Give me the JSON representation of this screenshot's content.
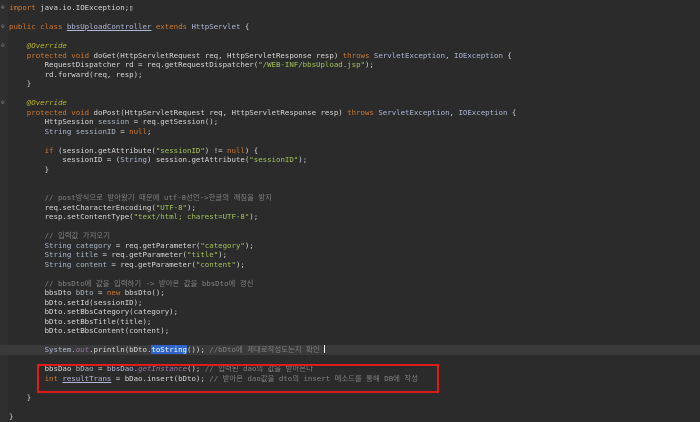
{
  "editor": {
    "lines": [
      {
        "fold": "⊕",
        "tokens": [
          {
            "t": "import",
            "c": "kw"
          },
          {
            "t": " java.io.IOException;",
            "c": "def"
          },
          {
            "t": "▯",
            "c": "def"
          }
        ]
      },
      {
        "tokens": []
      },
      {
        "fold": "⊖",
        "tokens": [
          {
            "t": "public class ",
            "c": "kw"
          },
          {
            "t": "bbsUploadController",
            "c": "link"
          },
          {
            "t": " extends ",
            "c": "kw"
          },
          {
            "t": "HttpServlet",
            "c": "cls"
          },
          {
            "t": " {",
            "c": "def"
          }
        ]
      },
      {
        "tokens": []
      },
      {
        "fold": "⊖",
        "tokens": [
          {
            "t": "    @Override",
            "c": "ann"
          }
        ]
      },
      {
        "tokens": [
          {
            "t": "    protected void ",
            "c": "kw"
          },
          {
            "t": "doGet",
            "c": "def"
          },
          {
            "t": "(HttpServletRequest req, HttpServletResponse resp) ",
            "c": "def"
          },
          {
            "t": "throws ",
            "c": "kw"
          },
          {
            "t": "ServletException",
            "c": "cls"
          },
          {
            "t": ", ",
            "c": "def"
          },
          {
            "t": "IOException",
            "c": "cls"
          },
          {
            "t": " {",
            "c": "def"
          }
        ]
      },
      {
        "tokens": [
          {
            "t": "        RequestDispatcher rd = req.getRequestDispatcher(",
            "c": "def"
          },
          {
            "t": "\"/WEB-INF/bbsUpload.jsp\"",
            "c": "str"
          },
          {
            "t": ");",
            "c": "def"
          }
        ]
      },
      {
        "tokens": [
          {
            "t": "        rd.forward(req, resp);",
            "c": "def"
          }
        ]
      },
      {
        "tokens": [
          {
            "t": "    }",
            "c": "def"
          }
        ]
      },
      {
        "tokens": []
      },
      {
        "fold": "⊖",
        "tokens": [
          {
            "t": "    @Override",
            "c": "ann"
          }
        ]
      },
      {
        "tokens": [
          {
            "t": "    protected void ",
            "c": "kw"
          },
          {
            "t": "doPost",
            "c": "def"
          },
          {
            "t": "(HttpServletRequest req, HttpServletResponse resp) ",
            "c": "def"
          },
          {
            "t": "throws ",
            "c": "kw"
          },
          {
            "t": "ServletException",
            "c": "cls"
          },
          {
            "t": ", ",
            "c": "def"
          },
          {
            "t": "IOException",
            "c": "cls"
          },
          {
            "t": " {",
            "c": "def"
          }
        ]
      },
      {
        "tokens": [
          {
            "t": "        HttpSession ",
            "c": "def"
          },
          {
            "t": "session",
            "c": "var"
          },
          {
            "t": " = req.getSession();",
            "c": "def"
          }
        ]
      },
      {
        "tokens": [
          {
            "t": "        String ",
            "c": "cls"
          },
          {
            "t": "sessionID",
            "c": "var"
          },
          {
            "t": " = ",
            "c": "def"
          },
          {
            "t": "null",
            "c": "kw"
          },
          {
            "t": ";",
            "c": "def"
          }
        ]
      },
      {
        "tokens": []
      },
      {
        "tokens": [
          {
            "t": "        if ",
            "c": "kw"
          },
          {
            "t": "(session.getAttribute(",
            "c": "def"
          },
          {
            "t": "\"sessionID\"",
            "c": "str"
          },
          {
            "t": ") != ",
            "c": "def"
          },
          {
            "t": "null",
            "c": "kw"
          },
          {
            "t": ") {",
            "c": "def"
          }
        ]
      },
      {
        "tokens": [
          {
            "t": "            sessionID = (",
            "c": "def"
          },
          {
            "t": "String",
            "c": "cls"
          },
          {
            "t": ") session.getAttribute(",
            "c": "def"
          },
          {
            "t": "\"sessionID\"",
            "c": "str"
          },
          {
            "t": ");",
            "c": "def"
          }
        ]
      },
      {
        "tokens": [
          {
            "t": "        }",
            "c": "def"
          }
        ]
      },
      {
        "tokens": []
      },
      {
        "tokens": []
      },
      {
        "tokens": [
          {
            "t": "        // post방식으로 받아왔기 때문에 utf-8선언->한글의 깨짐을 방지",
            "c": "cmt"
          }
        ]
      },
      {
        "tokens": [
          {
            "t": "        req.setCharacterEncoding(",
            "c": "def"
          },
          {
            "t": "\"UTF-8\"",
            "c": "str"
          },
          {
            "t": ");",
            "c": "def"
          }
        ]
      },
      {
        "tokens": [
          {
            "t": "        resp.setContentType(",
            "c": "def"
          },
          {
            "t": "\"text/html; charest=UTF-8\"",
            "c": "str"
          },
          {
            "t": ");",
            "c": "def"
          }
        ]
      },
      {
        "tokens": []
      },
      {
        "tokens": [
          {
            "t": "        // 입력값 가져오기",
            "c": "cmt"
          }
        ]
      },
      {
        "tokens": [
          {
            "t": "        String ",
            "c": "cls"
          },
          {
            "t": "category",
            "c": "var"
          },
          {
            "t": " = req.getParameter(",
            "c": "def"
          },
          {
            "t": "\"category\"",
            "c": "str"
          },
          {
            "t": ");",
            "c": "def"
          }
        ]
      },
      {
        "tokens": [
          {
            "t": "        String ",
            "c": "cls"
          },
          {
            "t": "title",
            "c": "var"
          },
          {
            "t": " = req.getParameter(",
            "c": "def"
          },
          {
            "t": "\"title\"",
            "c": "str"
          },
          {
            "t": ");",
            "c": "def"
          }
        ]
      },
      {
        "tokens": [
          {
            "t": "        String ",
            "c": "cls"
          },
          {
            "t": "content",
            "c": "var"
          },
          {
            "t": " = req.getParameter(",
            "c": "def"
          },
          {
            "t": "\"content\"",
            "c": "str"
          },
          {
            "t": ");",
            "c": "def"
          }
        ]
      },
      {
        "tokens": []
      },
      {
        "tokens": [
          {
            "t": "        // bbsDto에 값을 입력하기 -> 받아온 값을 bbsDto에 갱신",
            "c": "cmt"
          }
        ]
      },
      {
        "tokens": [
          {
            "t": "        bbsDto ",
            "c": "def"
          },
          {
            "t": "bDto",
            "c": "var"
          },
          {
            "t": " = ",
            "c": "def"
          },
          {
            "t": "new ",
            "c": "kw"
          },
          {
            "t": "bbsDto();",
            "c": "def"
          }
        ]
      },
      {
        "tokens": [
          {
            "t": "        bDto.setId(sessionID);",
            "c": "def"
          }
        ]
      },
      {
        "tokens": [
          {
            "t": "        bDto.setBbsCategory(category);",
            "c": "def"
          }
        ]
      },
      {
        "tokens": [
          {
            "t": "        bDto.setBbsTitle(title);",
            "c": "def"
          }
        ]
      },
      {
        "tokens": [
          {
            "t": "        bDto.setBbsContent(content);",
            "c": "def"
          }
        ]
      },
      {
        "tokens": []
      },
      {
        "hl": true,
        "tokens": [
          {
            "t": "        System.",
            "c": "cls"
          },
          {
            "t": "out",
            "c": "field"
          },
          {
            "t": ".println(bDto.",
            "c": "def"
          },
          {
            "t": "toString",
            "c": "sel"
          },
          {
            "t": "()); ",
            "c": "def"
          },
          {
            "t": "//bDto에 제대로작성도는지 확인 ",
            "c": "cmt"
          },
          {
            "t": "|",
            "c": "cur"
          }
        ]
      },
      {
        "tokens": []
      },
      {
        "tokens": [
          {
            "t": "        bbsDao ",
            "c": "def"
          },
          {
            "t": "bDao",
            "c": "var"
          },
          {
            "t": " = ",
            "c": "def"
          },
          {
            "t": "bbsDao.",
            "c": "cls"
          },
          {
            "t": "getInstance",
            "c": "field"
          },
          {
            "t": "(); ",
            "c": "def"
          },
          {
            "t": "// 입력된 dao의 값을 받아온다",
            "c": "cmt"
          }
        ]
      },
      {
        "tokens": [
          {
            "t": "        int ",
            "c": "kw"
          },
          {
            "t": "resultTrans",
            "c": "link"
          },
          {
            "t": " = bDao.insert(bDto); ",
            "c": "def"
          },
          {
            "t": "// 받아온 dao값을 dto의 insert 메소드를 통해 DB에 작성",
            "c": "cmt"
          }
        ]
      },
      {
        "tokens": []
      },
      {
        "tokens": [
          {
            "t": "    }",
            "c": "def"
          }
        ]
      },
      {
        "tokens": []
      },
      {
        "tokens": [
          {
            "t": "}",
            "c": "def"
          }
        ]
      }
    ]
  },
  "highlight": {
    "color": "#e11b1b"
  }
}
